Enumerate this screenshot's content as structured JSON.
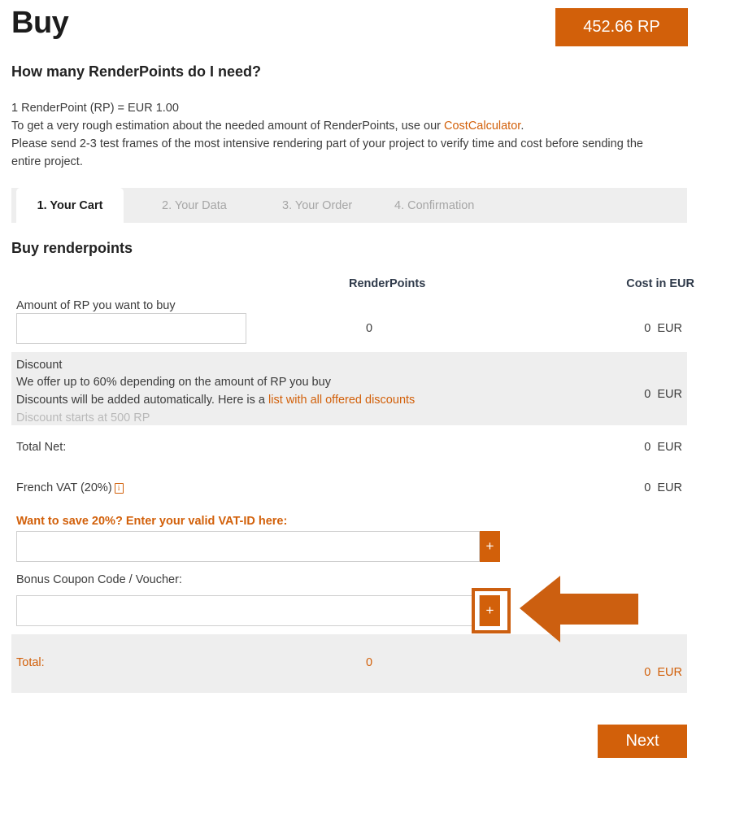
{
  "header": {
    "title": "Buy",
    "rp_badge": "452.66 RP"
  },
  "intro": {
    "heading": "How many RenderPoints do I need?",
    "line1": "1 RenderPoint (RP) = EUR 1.00",
    "line2_pre": "To get a very rough estimation about the needed amount of RenderPoints, use our ",
    "line2_link": "CostCalculator",
    "line2_post": ".",
    "line3": "Please send 2-3 test frames of the most intensive rendering part of your project to verify time and cost before sending the entire project."
  },
  "tabs": [
    {
      "label": "1. Your Cart",
      "active": true
    },
    {
      "label": "2. Your Data",
      "active": false
    },
    {
      "label": "3. Your Order",
      "active": false
    },
    {
      "label": "4. Confirmation",
      "active": false
    }
  ],
  "cart": {
    "heading": "Buy renderpoints",
    "columns": {
      "renderpoints": "RenderPoints",
      "cost": "Cost in EUR"
    },
    "amount_row": {
      "label": "Amount of RP you want to buy",
      "input_value": "",
      "input_placeholder": "",
      "renderpoints": "0",
      "cost": "0",
      "currency": "EUR"
    },
    "discount_row": {
      "title": "Discount",
      "line1": "We offer up to 60% depending on the amount of RP you buy",
      "line2_pre": "Discounts will be added automatically. Here is a ",
      "line2_link": "list with all offered discounts",
      "line3": "Discount starts at 500 RP",
      "cost": "0",
      "currency": "EUR"
    },
    "total_net_row": {
      "label": "Total Net:",
      "cost": "0",
      "currency": "EUR"
    },
    "vat_row": {
      "label": "French VAT (20%)",
      "info_icon": "info-icon",
      "cost": "0",
      "currency": "EUR"
    },
    "vat_id": {
      "label": "Want to save 20%? Enter your valid VAT-ID here:",
      "input_value": "",
      "input_placeholder": "",
      "add_button": "+"
    },
    "coupon": {
      "label": "Bonus Coupon Code / Voucher:",
      "input_value": "",
      "input_placeholder": "",
      "add_button": "+"
    },
    "total_row": {
      "label": "Total:",
      "renderpoints": "0",
      "cost": "0",
      "currency": "EUR"
    }
  },
  "footer": {
    "next_button": "Next"
  },
  "annotation": {
    "arrow": "left-arrow-pointer",
    "target": "coupon-add-button"
  },
  "colors": {
    "accent": "#d2600a",
    "highlight": "#cc5f10",
    "row_shade": "#eeeeee",
    "tabbar": "#eeeeee",
    "text": "#3c3c3c",
    "muted": "#b9b9b9"
  }
}
